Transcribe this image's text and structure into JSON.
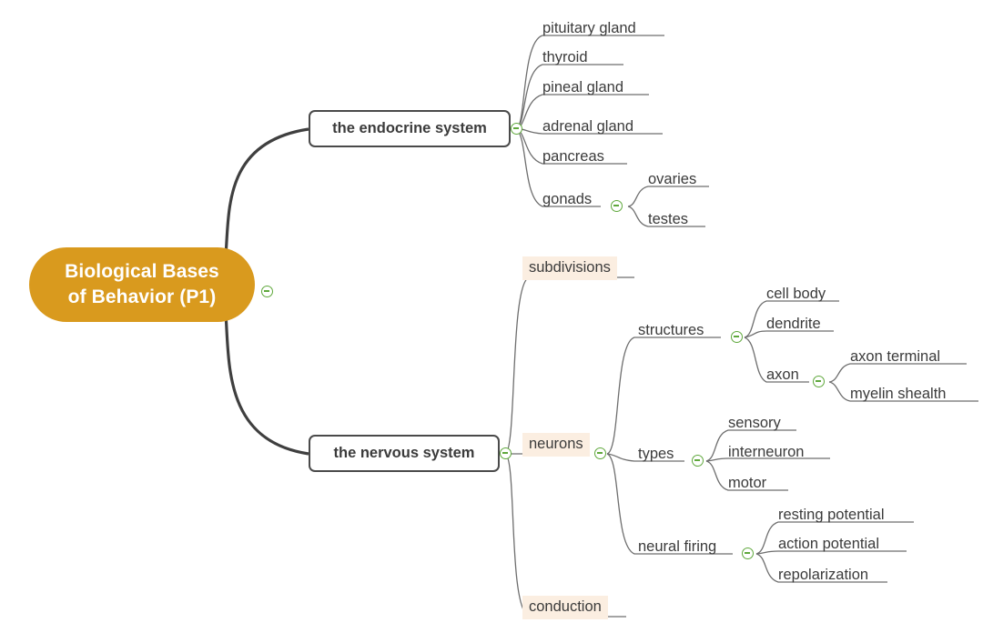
{
  "diagram": {
    "type": "mind-map",
    "title": "Biological Bases of Behavior (P1)",
    "colors": {
      "root_fill": "#D99A1E",
      "root_text": "#FFFFFF",
      "branch_border": "#4A4A4A",
      "branch_text": "#3B3B3B",
      "highlight_fill": "#FBEEE1",
      "toggle_stroke": "#5FA83C",
      "link_main": "#3F3F3F",
      "link_sub": "#6E6E6E",
      "background": "#FFFFFF"
    },
    "root": {
      "label": "Biological Bases\nof Behavior (P1)",
      "line1": "Biological Bases",
      "line2": "of Behavior (P1)"
    },
    "branches": [
      {
        "id": "endocrine",
        "label": "the endocrine system",
        "children": [
          {
            "id": "pituitary-gland",
            "label": "pituitary gland"
          },
          {
            "id": "thyroid",
            "label": "thyroid"
          },
          {
            "id": "pineal-gland",
            "label": "pineal gland"
          },
          {
            "id": "adrenal-gland",
            "label": "adrenal gland"
          },
          {
            "id": "pancreas",
            "label": "pancreas"
          },
          {
            "id": "gonads",
            "label": "gonads",
            "children": [
              {
                "id": "ovaries",
                "label": "ovaries"
              },
              {
                "id": "testes",
                "label": "testes"
              }
            ]
          }
        ]
      },
      {
        "id": "nervous",
        "label": "the nervous system",
        "children": [
          {
            "id": "subdivisions",
            "label": "subdivisions",
            "highlighted": true
          },
          {
            "id": "neurons",
            "label": "neurons",
            "highlighted": true,
            "children": [
              {
                "id": "structures",
                "label": "structures",
                "children": [
                  {
                    "id": "cell-body",
                    "label": "cell body"
                  },
                  {
                    "id": "dendrite",
                    "label": "dendrite"
                  },
                  {
                    "id": "axon",
                    "label": "axon",
                    "children": [
                      {
                        "id": "axon-terminal",
                        "label": "axon terminal"
                      },
                      {
                        "id": "myelin-shealth",
                        "label": "myelin shealth"
                      }
                    ]
                  }
                ]
              },
              {
                "id": "types",
                "label": "types",
                "children": [
                  {
                    "id": "sensory",
                    "label": "sensory"
                  },
                  {
                    "id": "interneuron",
                    "label": "interneuron"
                  },
                  {
                    "id": "motor",
                    "label": "motor"
                  }
                ]
              },
              {
                "id": "neural-firing",
                "label": "neural firing",
                "children": [
                  {
                    "id": "resting-potential",
                    "label": "resting potential"
                  },
                  {
                    "id": "action-potential",
                    "label": "action potential"
                  },
                  {
                    "id": "repolarization",
                    "label": "repolarization"
                  }
                ]
              }
            ]
          },
          {
            "id": "conduction",
            "label": "conduction",
            "highlighted": true
          }
        ]
      }
    ]
  }
}
